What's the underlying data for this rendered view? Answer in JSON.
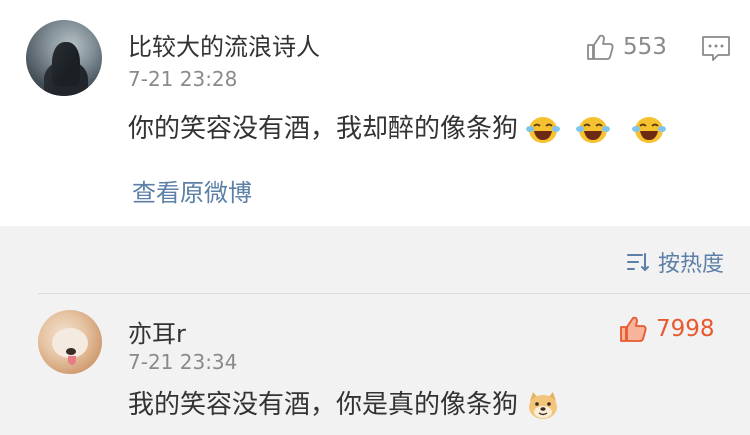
{
  "post": {
    "username": "比较大的流浪诗人",
    "timestamp": "7-21 23:28",
    "text": "你的笑容没有酒，我却醉的像条狗",
    "emojis": [
      "laugh-cry-emoji",
      "laugh-cry-emoji",
      "laugh-cry-emoji"
    ],
    "likes": "553",
    "view_original": "查看原微博",
    "icons": {
      "like": "thumbs-up-icon",
      "comment": "comment-icon"
    }
  },
  "sort": {
    "label": "按热度",
    "icon": "sort-icon"
  },
  "comments": [
    {
      "username": "亦耳r",
      "timestamp": "7-21 23:34",
      "text": "我的笑容没有酒，你是真的像条狗",
      "emoji": "doge-emoji",
      "likes": "7998",
      "liked": true
    }
  ],
  "colors": {
    "link": "#5b7fa6",
    "liked": "#e8592f",
    "muted": "#8a8a8a",
    "text": "#333333",
    "background": "#f2f2f2"
  }
}
